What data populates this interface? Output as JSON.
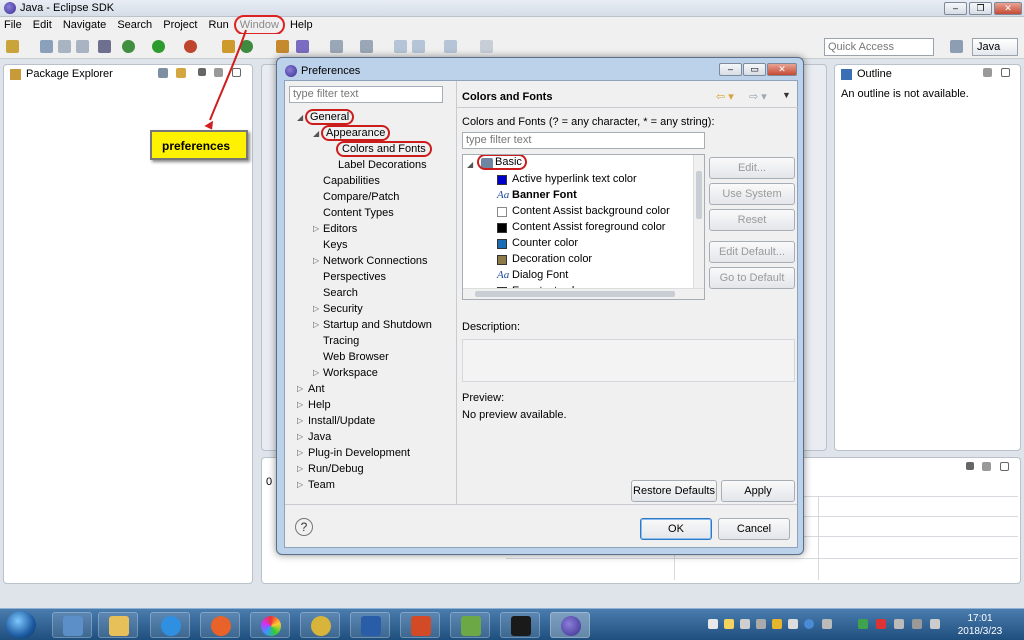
{
  "window": {
    "title": "Java - Eclipse SDK"
  },
  "menu": [
    "File",
    "Edit",
    "Navigate",
    "Search",
    "Project",
    "Run",
    "Window",
    "Help"
  ],
  "toolbar": {
    "quick_access_placeholder": "Quick Access",
    "perspective": "Java"
  },
  "package_explorer": {
    "title": "Package Explorer"
  },
  "outline": {
    "title": "Outline",
    "message": "An outline is not available."
  },
  "annotation": {
    "label": "preferences"
  },
  "bottom_pane": {
    "row0": "0"
  },
  "preferences": {
    "title": "Preferences",
    "filter_placeholder": "type filter text",
    "tree": {
      "general": "General",
      "appearance": "Appearance",
      "colors_fonts": "Colors and Fonts",
      "label_decorations": "Label Decorations",
      "general_children": [
        "Capabilities",
        "Compare/Patch",
        "Content Types",
        "Editors",
        "Keys",
        "Network Connections",
        "Perspectives",
        "Search",
        "Security",
        "Startup and Shutdown",
        "Tracing",
        "Web Browser",
        "Workspace"
      ],
      "top_level": [
        "Ant",
        "Help",
        "Install/Update",
        "Java",
        "Plug-in Development",
        "Run/Debug",
        "Team"
      ]
    },
    "page": {
      "title": "Colors and Fonts",
      "hint": "Colors and Fonts (? = any character, * = any string):",
      "filter_placeholder": "type filter text",
      "category": "Basic",
      "items": [
        {
          "label": "Active hyperlink text color",
          "kind": "color",
          "color": "#0000cc"
        },
        {
          "label": "Banner Font",
          "kind": "font",
          "bold": true
        },
        {
          "label": "Content Assist background color",
          "kind": "color",
          "color": "#ffffff"
        },
        {
          "label": "Content Assist foreground color",
          "kind": "color",
          "color": "#000000"
        },
        {
          "label": "Counter color",
          "kind": "color",
          "color": "#1c6eb4"
        },
        {
          "label": "Decoration color",
          "kind": "color",
          "color": "#8c7a4a"
        },
        {
          "label": "Dialog Font",
          "kind": "font",
          "bold": false
        },
        {
          "label": "Error text color",
          "kind": "color",
          "color": "#e00000"
        }
      ],
      "buttons": {
        "edit": "Edit...",
        "use_system_font": "Use System Font",
        "reset": "Reset",
        "edit_default": "Edit Default...",
        "go_to_default": "Go to Default"
      },
      "description_label": "Description:",
      "preview_label": "Preview:",
      "preview_text": "No preview available.",
      "restore_defaults": "Restore Defaults",
      "apply": "Apply"
    },
    "ok": "OK",
    "cancel": "Cancel"
  },
  "clock": {
    "time": "17:01",
    "date": "2018/3/23"
  }
}
